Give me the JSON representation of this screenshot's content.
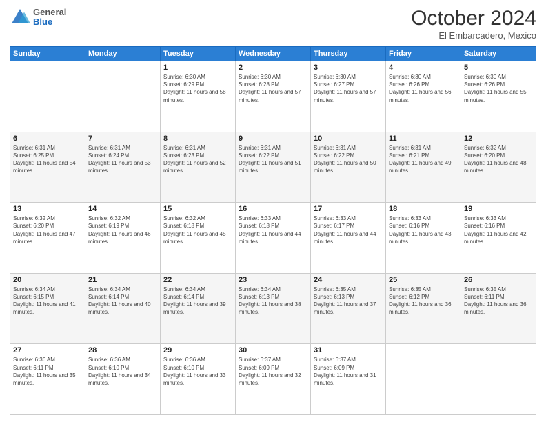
{
  "header": {
    "logo": {
      "general": "General",
      "blue": "Blue"
    },
    "title": "October 2024",
    "location": "El Embarcadero, Mexico"
  },
  "calendar": {
    "days_of_week": [
      "Sunday",
      "Monday",
      "Tuesday",
      "Wednesday",
      "Thursday",
      "Friday",
      "Saturday"
    ],
    "weeks": [
      [
        {
          "day": "",
          "info": ""
        },
        {
          "day": "",
          "info": ""
        },
        {
          "day": "1",
          "info": "Sunrise: 6:30 AM\nSunset: 6:29 PM\nDaylight: 11 hours and 58 minutes."
        },
        {
          "day": "2",
          "info": "Sunrise: 6:30 AM\nSunset: 6:28 PM\nDaylight: 11 hours and 57 minutes."
        },
        {
          "day": "3",
          "info": "Sunrise: 6:30 AM\nSunset: 6:27 PM\nDaylight: 11 hours and 57 minutes."
        },
        {
          "day": "4",
          "info": "Sunrise: 6:30 AM\nSunset: 6:26 PM\nDaylight: 11 hours and 56 minutes."
        },
        {
          "day": "5",
          "info": "Sunrise: 6:30 AM\nSunset: 6:26 PM\nDaylight: 11 hours and 55 minutes."
        }
      ],
      [
        {
          "day": "6",
          "info": "Sunrise: 6:31 AM\nSunset: 6:25 PM\nDaylight: 11 hours and 54 minutes."
        },
        {
          "day": "7",
          "info": "Sunrise: 6:31 AM\nSunset: 6:24 PM\nDaylight: 11 hours and 53 minutes."
        },
        {
          "day": "8",
          "info": "Sunrise: 6:31 AM\nSunset: 6:23 PM\nDaylight: 11 hours and 52 minutes."
        },
        {
          "day": "9",
          "info": "Sunrise: 6:31 AM\nSunset: 6:22 PM\nDaylight: 11 hours and 51 minutes."
        },
        {
          "day": "10",
          "info": "Sunrise: 6:31 AM\nSunset: 6:22 PM\nDaylight: 11 hours and 50 minutes."
        },
        {
          "day": "11",
          "info": "Sunrise: 6:31 AM\nSunset: 6:21 PM\nDaylight: 11 hours and 49 minutes."
        },
        {
          "day": "12",
          "info": "Sunrise: 6:32 AM\nSunset: 6:20 PM\nDaylight: 11 hours and 48 minutes."
        }
      ],
      [
        {
          "day": "13",
          "info": "Sunrise: 6:32 AM\nSunset: 6:20 PM\nDaylight: 11 hours and 47 minutes."
        },
        {
          "day": "14",
          "info": "Sunrise: 6:32 AM\nSunset: 6:19 PM\nDaylight: 11 hours and 46 minutes."
        },
        {
          "day": "15",
          "info": "Sunrise: 6:32 AM\nSunset: 6:18 PM\nDaylight: 11 hours and 45 minutes."
        },
        {
          "day": "16",
          "info": "Sunrise: 6:33 AM\nSunset: 6:18 PM\nDaylight: 11 hours and 44 minutes."
        },
        {
          "day": "17",
          "info": "Sunrise: 6:33 AM\nSunset: 6:17 PM\nDaylight: 11 hours and 44 minutes."
        },
        {
          "day": "18",
          "info": "Sunrise: 6:33 AM\nSunset: 6:16 PM\nDaylight: 11 hours and 43 minutes."
        },
        {
          "day": "19",
          "info": "Sunrise: 6:33 AM\nSunset: 6:16 PM\nDaylight: 11 hours and 42 minutes."
        }
      ],
      [
        {
          "day": "20",
          "info": "Sunrise: 6:34 AM\nSunset: 6:15 PM\nDaylight: 11 hours and 41 minutes."
        },
        {
          "day": "21",
          "info": "Sunrise: 6:34 AM\nSunset: 6:14 PM\nDaylight: 11 hours and 40 minutes."
        },
        {
          "day": "22",
          "info": "Sunrise: 6:34 AM\nSunset: 6:14 PM\nDaylight: 11 hours and 39 minutes."
        },
        {
          "day": "23",
          "info": "Sunrise: 6:34 AM\nSunset: 6:13 PM\nDaylight: 11 hours and 38 minutes."
        },
        {
          "day": "24",
          "info": "Sunrise: 6:35 AM\nSunset: 6:13 PM\nDaylight: 11 hours and 37 minutes."
        },
        {
          "day": "25",
          "info": "Sunrise: 6:35 AM\nSunset: 6:12 PM\nDaylight: 11 hours and 36 minutes."
        },
        {
          "day": "26",
          "info": "Sunrise: 6:35 AM\nSunset: 6:11 PM\nDaylight: 11 hours and 36 minutes."
        }
      ],
      [
        {
          "day": "27",
          "info": "Sunrise: 6:36 AM\nSunset: 6:11 PM\nDaylight: 11 hours and 35 minutes."
        },
        {
          "day": "28",
          "info": "Sunrise: 6:36 AM\nSunset: 6:10 PM\nDaylight: 11 hours and 34 minutes."
        },
        {
          "day": "29",
          "info": "Sunrise: 6:36 AM\nSunset: 6:10 PM\nDaylight: 11 hours and 33 minutes."
        },
        {
          "day": "30",
          "info": "Sunrise: 6:37 AM\nSunset: 6:09 PM\nDaylight: 11 hours and 32 minutes."
        },
        {
          "day": "31",
          "info": "Sunrise: 6:37 AM\nSunset: 6:09 PM\nDaylight: 11 hours and 31 minutes."
        },
        {
          "day": "",
          "info": ""
        },
        {
          "day": "",
          "info": ""
        }
      ]
    ]
  }
}
